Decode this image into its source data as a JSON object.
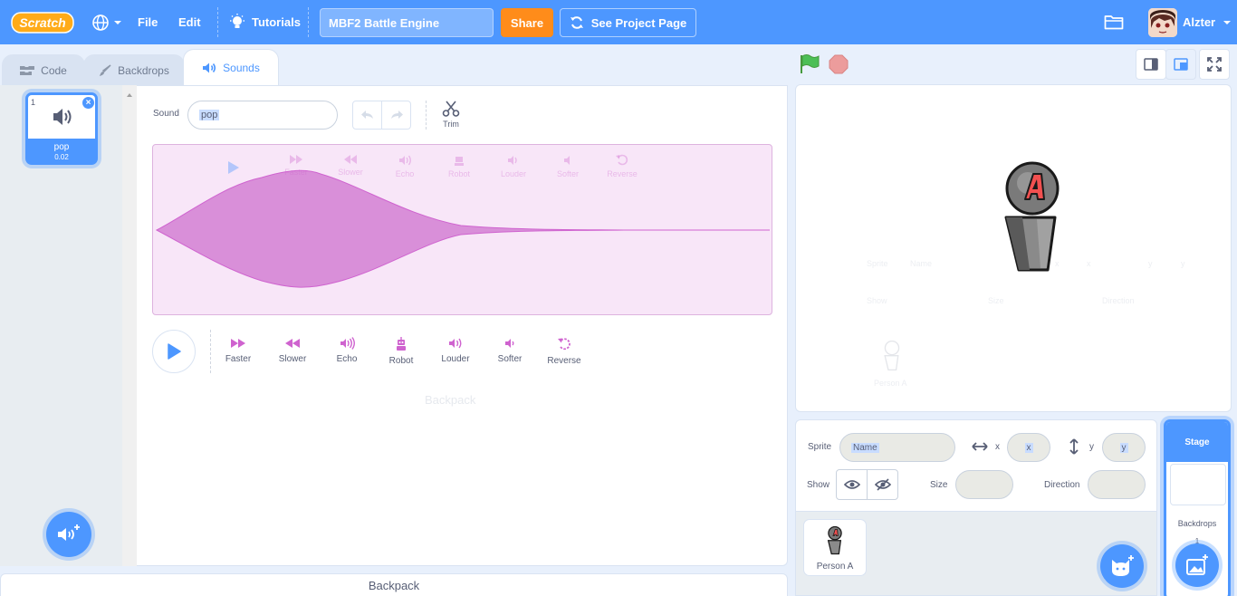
{
  "menubar": {
    "logo_text": "Scratch",
    "file": "File",
    "edit": "Edit",
    "tutorials": "Tutorials",
    "project_title": "MBF2 Battle Engine",
    "share": "Share",
    "see_project_page": "See Project Page",
    "username": "Alzter"
  },
  "tabs": {
    "code": "Code",
    "backdrops": "Backdrops",
    "sounds": "Sounds"
  },
  "sound_list": {
    "items": [
      {
        "index": "1",
        "name": "pop",
        "duration": "0.02"
      }
    ]
  },
  "editor": {
    "sound_label": "Sound",
    "sound_name": "pop",
    "trim": "Trim",
    "effects": [
      "Faster",
      "Slower",
      "Echo",
      "Robot",
      "Louder",
      "Softer",
      "Reverse"
    ],
    "ghost_backpack": "Backpack"
  },
  "backpack": {
    "label": "Backpack"
  },
  "stage_ghost": {
    "sprite": "Sprite",
    "name": "Name",
    "x": "x",
    "y": "y",
    "show": "Show",
    "size": "Size",
    "direction": "Direction",
    "person": "Person A"
  },
  "sprite_info": {
    "sprite_label": "Sprite",
    "name_placeholder": "Name",
    "x_label": "x",
    "x_placeholder": "x",
    "y_label": "y",
    "y_placeholder": "y",
    "show_label": "Show",
    "size_label": "Size",
    "direction_label": "Direction"
  },
  "sprites": [
    {
      "name": "Person A"
    }
  ],
  "stage_selector": {
    "title": "Stage",
    "backdrops_label": "Backdrops",
    "backdrops_count": "1"
  },
  "colors": {
    "menubar": "#4d97ff",
    "share": "#ff8c1a",
    "wave_fill": "#d98fd9",
    "effect": "#cf63cf"
  }
}
